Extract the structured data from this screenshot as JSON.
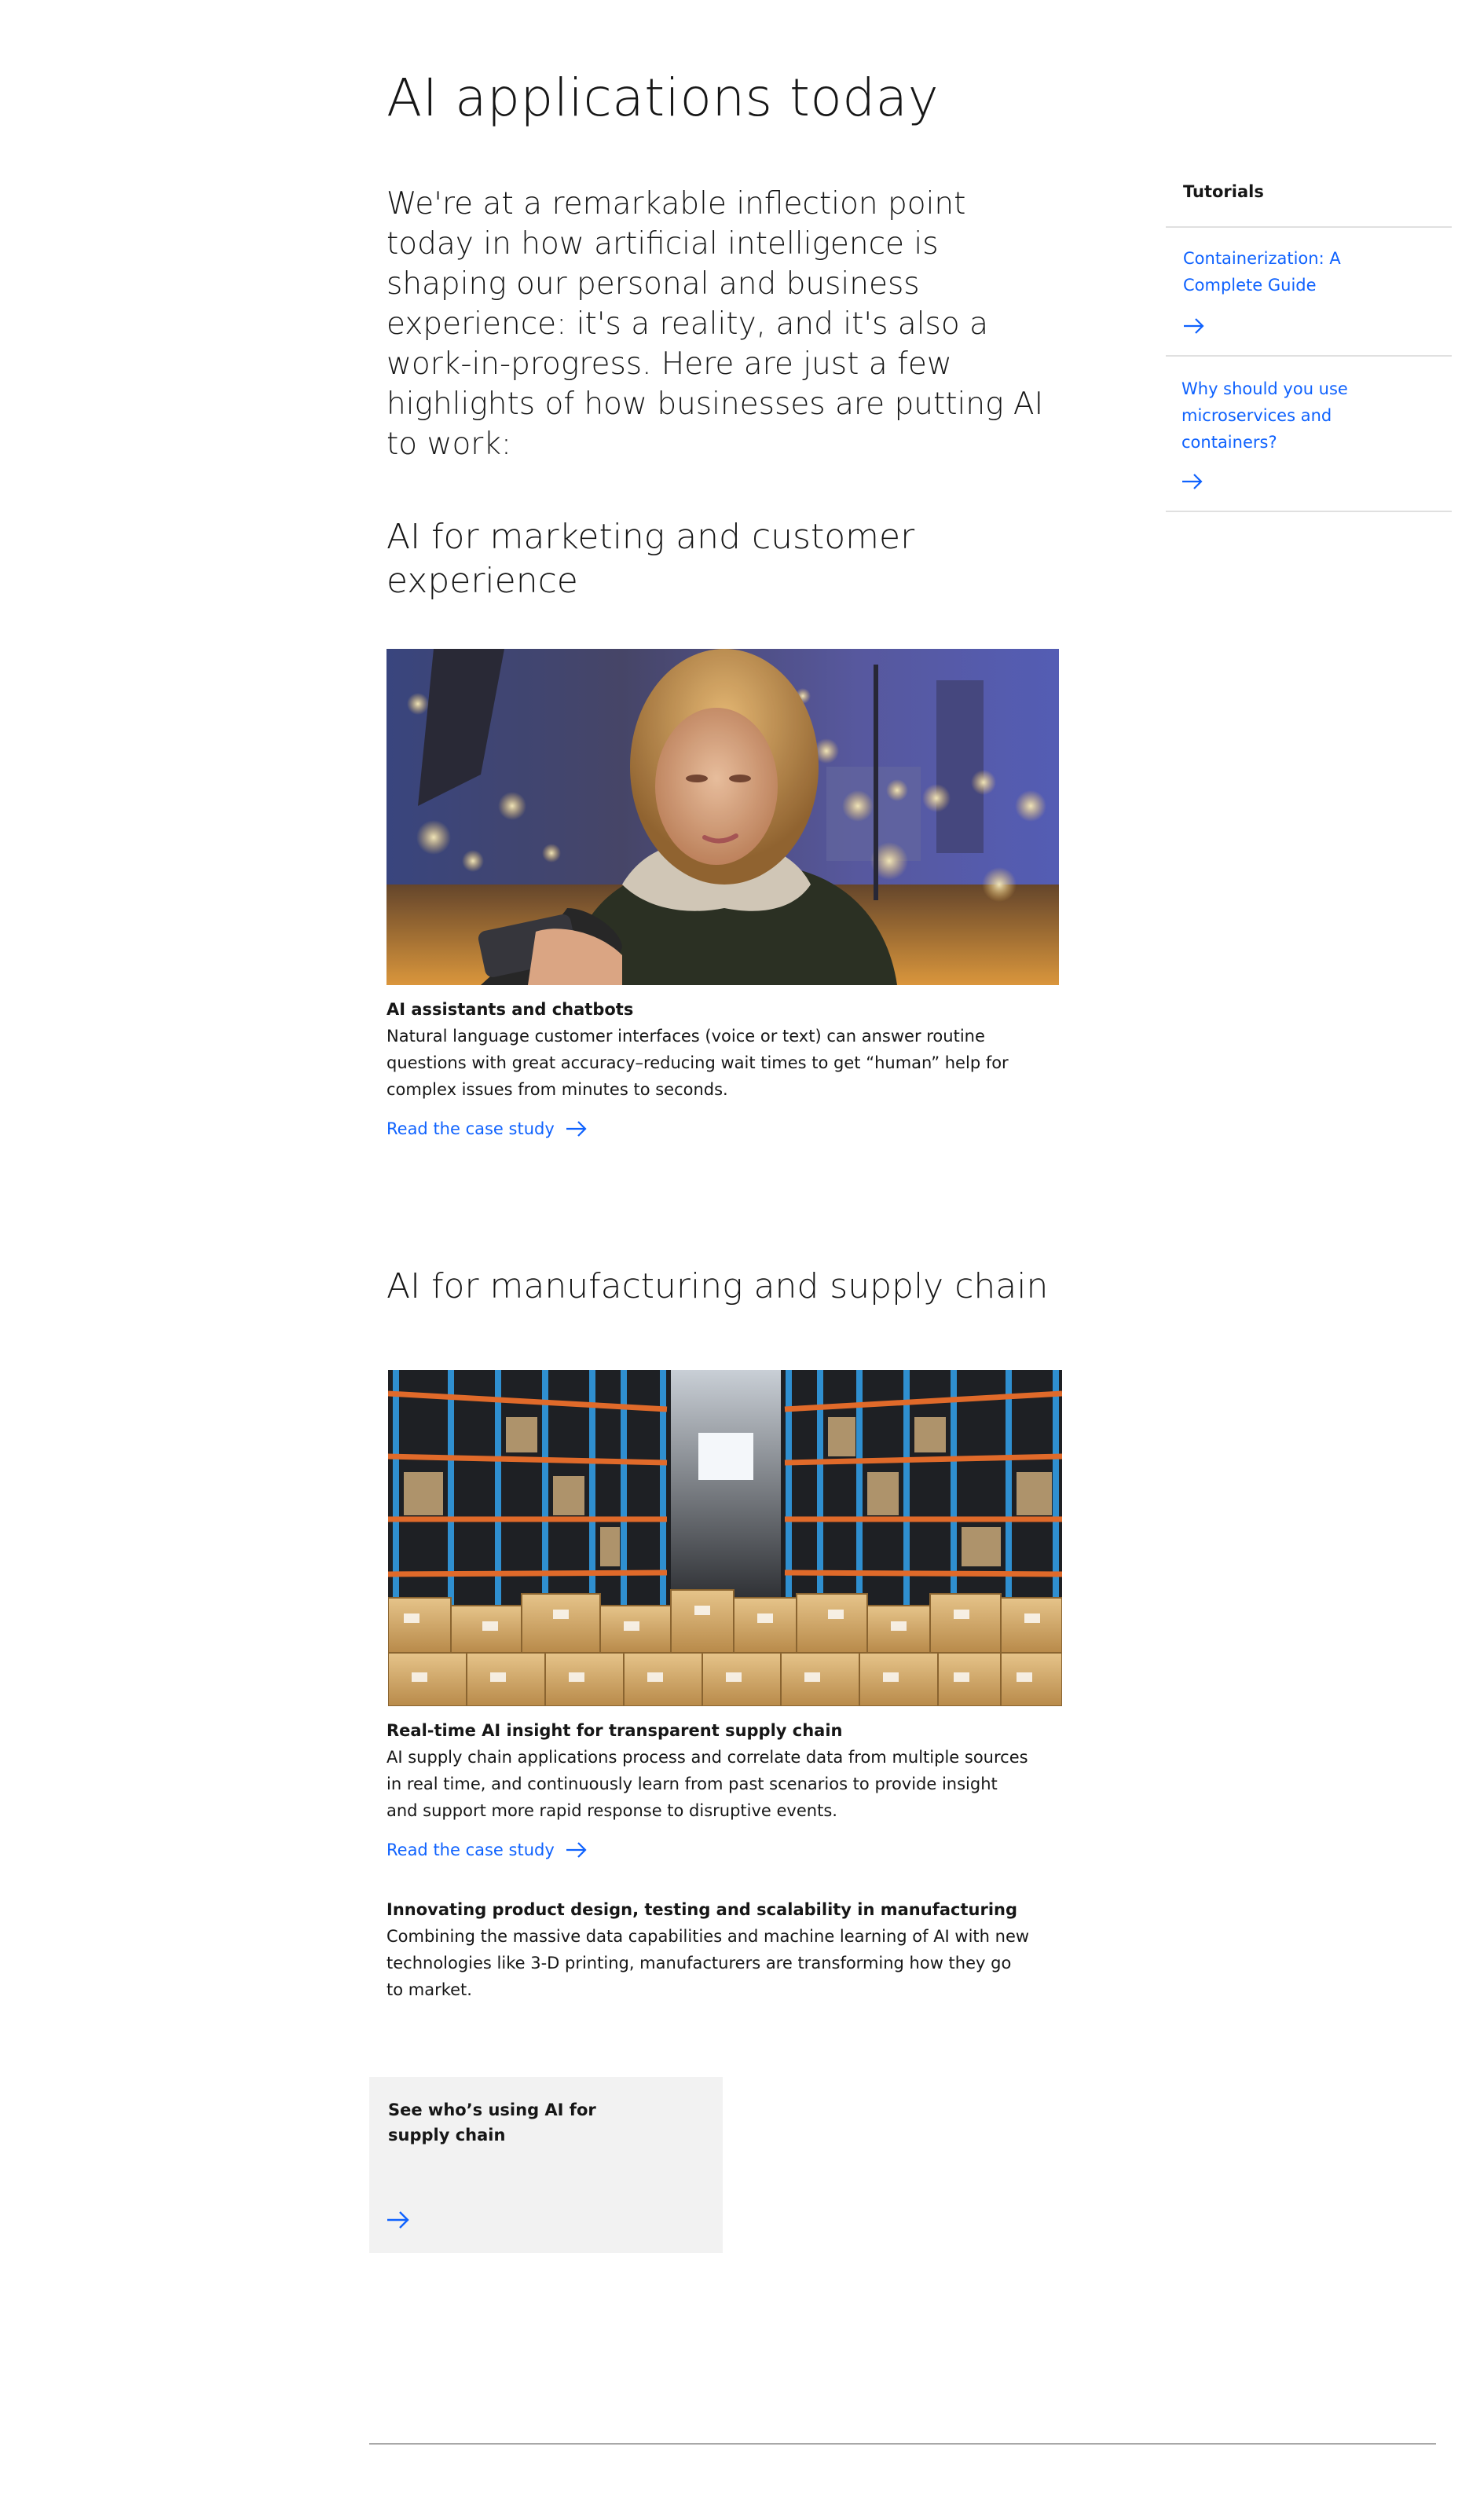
{
  "page": {
    "title": "AI applications today",
    "lead": "We're at a remarkable inflection point today in how artificial intelligence is shaping our personal and business experience: it's a reality, and it's also a work-in-progress. Here are just a few highlights of how businesses are putting AI to work:"
  },
  "marketing": {
    "title": "AI for marketing and customer experience",
    "image_subject": "woman-looking-at-phone-city-night",
    "item_title": "AI assistants and chatbots",
    "item_body": "Natural language customer interfaces (voice or text) can answer routine questions with great accuracy–reducing wait times to get “human” help for complex issues from minutes to seconds.",
    "link_label": "Read the case study"
  },
  "manufacturing": {
    "title": "AI for manufacturing and supply chain",
    "image_subject": "warehouse-shelves-with-boxes",
    "item1_title": "Real-time AI insight for transparent supply chain",
    "item1_body": "AI supply chain applications process and correlate data from multiple sources in real time, and continuously learn from past scenarios to provide insight and support more rapid response to disruptive events.",
    "link_label": "Read the case study",
    "item2_title": "Innovating product design, testing and scalability in manufacturing",
    "item2_body": "Combining the massive data capabilities and machine learning of AI with new technologies like 3-D printing, manufacturers are transforming how they go to market."
  },
  "tile": {
    "title": "See who’s using AI for supply chain"
  },
  "sidebar": {
    "heading": "Tutorials",
    "items": [
      {
        "label": "Containerization: A Complete Guide"
      },
      {
        "label": "Why should you use microservices and containers?"
      }
    ]
  },
  "colors": {
    "link": "#0f62fe",
    "text": "#161616",
    "tile_bg": "#f2f2f2",
    "rule": "#e0e0e0"
  }
}
